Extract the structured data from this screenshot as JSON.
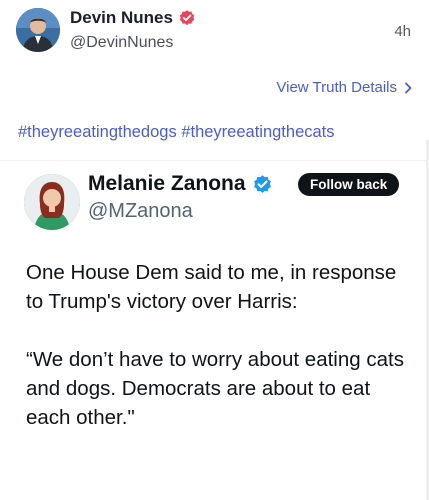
{
  "post": {
    "author_name": "Devin Nunes",
    "handle": "@DevinNunes",
    "time": "4h",
    "details_link": "View Truth Details",
    "hashtags": [
      "#theyreeatingthedogs",
      "#theyreeatingthecats"
    ]
  },
  "embed": {
    "author_name": "Melanie Zanona",
    "handle": "@MZanona",
    "follow_label": "Follow back",
    "body_lines": [
      "One House Dem said to me, in response to Trump's victory over Harris:",
      "“We don’t have to worry about eating cats and dogs. Democrats are about to eat each other.\""
    ]
  },
  "colors": {
    "link": "#4a5bd6",
    "truth_verified": "#e8475a",
    "x_verified": "#1d9bf0",
    "follow_button": "#0f1419"
  },
  "icons": {
    "truth_verified": "verified-badge-icon",
    "x_verified": "verified-badge-icon",
    "details_chevron": "chevron-right-icon"
  }
}
